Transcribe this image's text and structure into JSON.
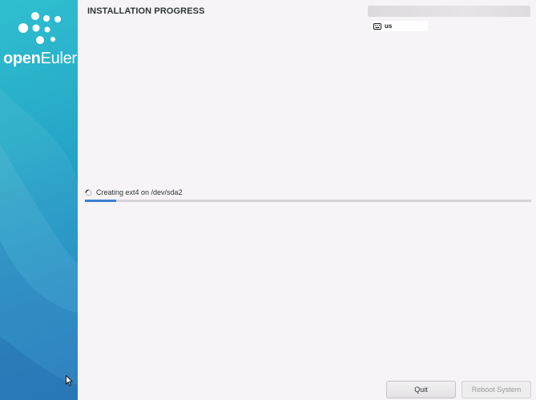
{
  "sidebar": {
    "logo_prefix": "open",
    "logo_suffix": "Euler"
  },
  "header": {
    "title": "INSTALLATION PROGRESS",
    "keyboard_layout": "us"
  },
  "progress": {
    "status_text": "Creating ext4 on /dev/sda2",
    "fraction": 0.07
  },
  "buttons": {
    "quit_label": "Quit",
    "reboot_label": "Reboot System",
    "reboot_enabled": false
  },
  "colors": {
    "accent": "#3b7fd0",
    "sidebar_top": "#2fbfd0",
    "sidebar_bottom": "#1a79be"
  }
}
